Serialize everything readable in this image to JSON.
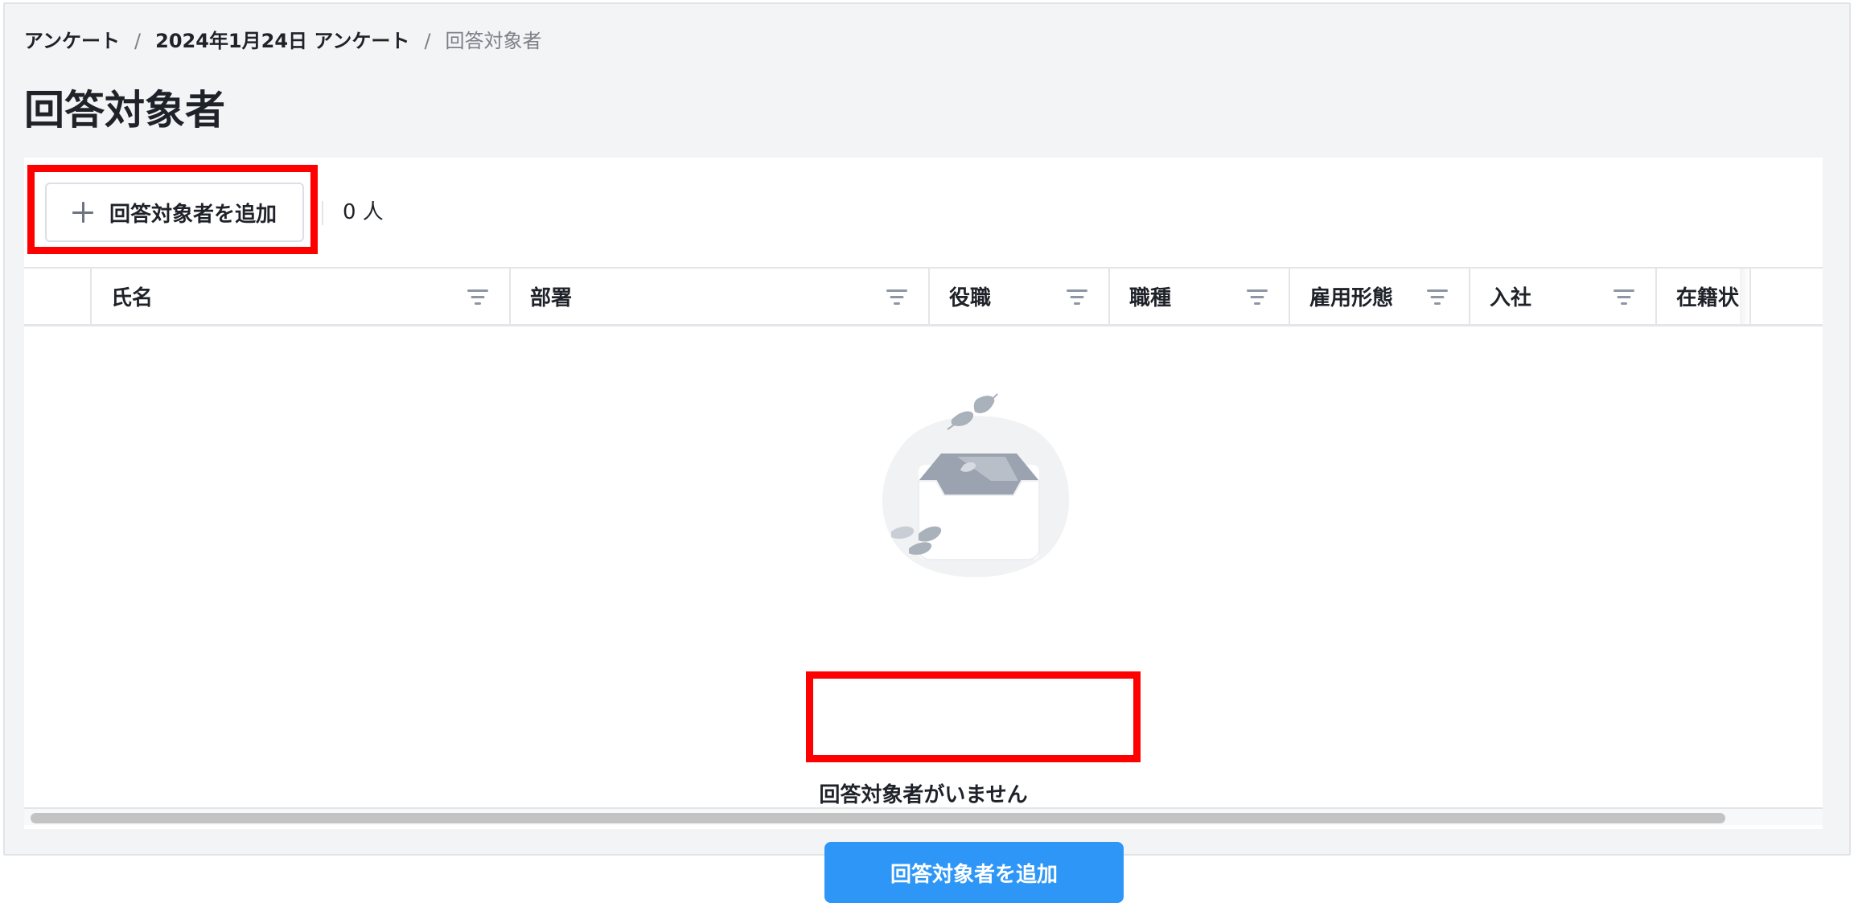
{
  "breadcrumb": {
    "items": [
      "アンケート",
      "2024年1月24日 アンケート",
      "回答対象者"
    ],
    "separator": "/"
  },
  "page_title": "回答対象者",
  "toolbar": {
    "add_label": "回答対象者を追加",
    "count": "0 人"
  },
  "table": {
    "columns": [
      "氏名",
      "部署",
      "役職",
      "職種",
      "雇用形態",
      "入社",
      "在籍状"
    ]
  },
  "empty_state": {
    "message": "回答対象者がいません",
    "button_label": "回答対象者を追加"
  },
  "colors": {
    "primary": "#2d96f6",
    "highlight": "#ff0000",
    "page_bg": "#f3f4f6"
  },
  "icons": {
    "add": "plus-icon",
    "filter": "filter-icon",
    "empty": "empty-inbox-icon"
  }
}
